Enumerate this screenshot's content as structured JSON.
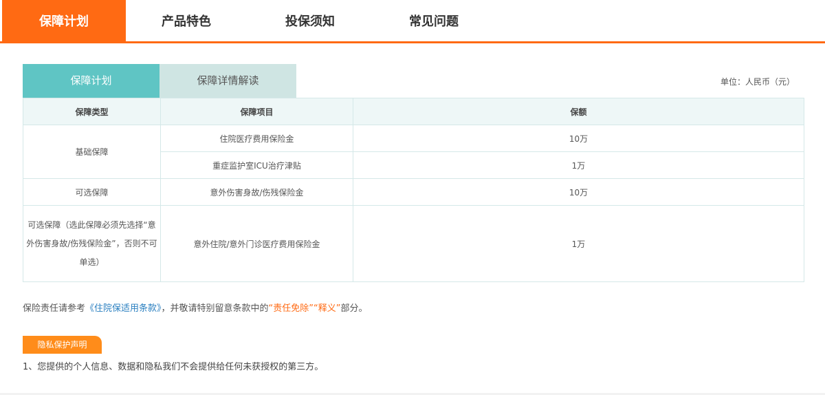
{
  "top_tabs": [
    "保障计划",
    "产品特色",
    "投保须知",
    "常见问题"
  ],
  "sub_tabs": [
    "保障计划",
    "保障详情解读"
  ],
  "unit_label": "单位：人民币（元）",
  "table": {
    "headers": [
      "保障类型",
      "保障项目",
      "保额"
    ],
    "groups": [
      {
        "type": "基础保障",
        "rows": [
          {
            "item": "住院医疗费用保险金",
            "amount": "10万"
          },
          {
            "item": "重症监护室ICU治疗津贴",
            "amount": "1万"
          }
        ]
      },
      {
        "type": "可选保障",
        "rows": [
          {
            "item": "意外伤害身故/伤残保险金",
            "amount": "10万"
          }
        ]
      },
      {
        "type_lines": [
          "可选保障（选此保障必须先选择“意",
          "外伤害身故/伤残保险金”，否则不可",
          "单选）"
        ],
        "rows": [
          {
            "item": "意外住院/意外门诊医疗费用保险金",
            "amount": "1万"
          }
        ]
      }
    ]
  },
  "note": {
    "prefix": "保险责任请参考",
    "link": "《住院保适用条款》",
    "middle": "，并敬请特别留意条款中的",
    "warn1": "“责任免除”",
    "warn2": "“释义”",
    "suffix": "部分。"
  },
  "privacy": {
    "badge": "隐私保护声明",
    "text": "1、您提供的个人信息、数据和隐私我们不会提供给任何未获授权的第三方。"
  },
  "colors": {
    "accent": "#ff6a13",
    "teal": "#5fc5c4",
    "teal_light": "#cfe5e3",
    "link": "#2a7fc0"
  }
}
